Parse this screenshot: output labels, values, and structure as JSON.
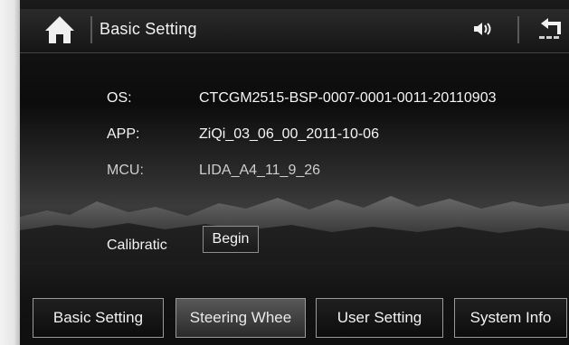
{
  "header": {
    "title": "Basic Setting",
    "icons": {
      "home": "home-icon",
      "volume": "volume-icon",
      "back": "back-arrow-icon"
    }
  },
  "info": {
    "os_label": "OS:",
    "os_value": "CTCGM2515-BSP-0007-0001-0011-20110903",
    "app_label": "APP:",
    "app_value": "ZiQi_03_06_00_2011-10-06",
    "mcu_label": "MCU:",
    "mcu_value": "LIDA_A4_11_9_26"
  },
  "calibration": {
    "label": "Calibratic",
    "begin_label": "Begin"
  },
  "tabs": [
    {
      "label": "Basic Setting",
      "active": false
    },
    {
      "label": "Steering Whee",
      "active": true
    },
    {
      "label": "User Setting",
      "active": false
    },
    {
      "label": "System Info",
      "active": false
    }
  ],
  "colors": {
    "background": "#111111",
    "text": "#f2f2f2",
    "border": "#9a9a9a"
  }
}
